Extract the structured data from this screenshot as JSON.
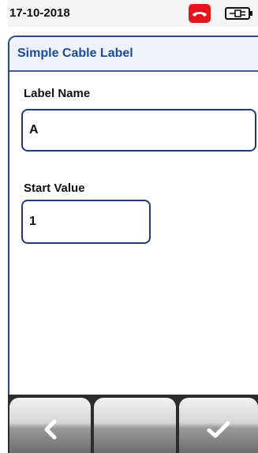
{
  "status_bar": {
    "date": "17-10-2018",
    "phone_icon": "hang-up-phone-icon",
    "phone_icon_color": "#e8141b",
    "battery_icon": "battery-plugged-icon"
  },
  "screen": {
    "title": "Simple Cable Label"
  },
  "fields": {
    "label_name": {
      "label": "Label Name",
      "value": "A"
    },
    "start_value": {
      "label": "Start Value",
      "value": "1"
    }
  },
  "softkeys": [
    {
      "name": "back",
      "icon": "chevron-left-icon"
    },
    {
      "name": "blank",
      "icon": ""
    },
    {
      "name": "confirm",
      "icon": "checkmark-icon"
    }
  ],
  "colors": {
    "title_text": "#1e4a9a",
    "border": "#1f3c78"
  }
}
